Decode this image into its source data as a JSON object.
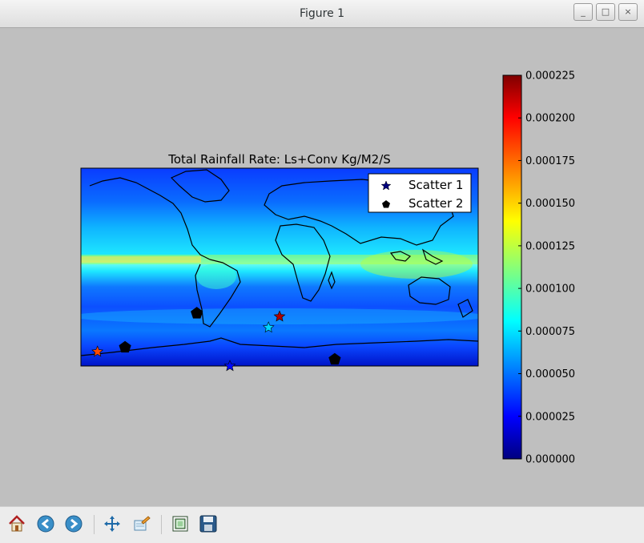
{
  "window": {
    "title": "Figure 1",
    "minimize_label": "_",
    "maximize_label": "□",
    "close_label": "×"
  },
  "chart_data": {
    "type": "heatmap",
    "title": "Total Rainfall Rate: Ls+Conv Kg/M2/S",
    "xlabel": "",
    "ylabel": "",
    "map": "world coastlines, global rainfall field",
    "colormap": "jet",
    "colorbar": {
      "ticks": [
        "0.000000",
        "0.000025",
        "0.000050",
        "0.000075",
        "0.000100",
        "0.000125",
        "0.000150",
        "0.000175",
        "0.000200",
        "0.000225"
      ],
      "vmin": 0,
      "vmax": 0.000225
    },
    "legend": {
      "placement": "top-right",
      "entries": [
        {
          "label": "Scatter 1",
          "marker": "star"
        },
        {
          "label": "Scatter 2",
          "marker": "pentagon"
        }
      ]
    },
    "scatter_series": [
      {
        "name": "Scatter 1",
        "marker": "star",
        "points": [
          {
            "lon": 0,
            "lat": -45,
            "value": 0.000215
          },
          {
            "lon": -10,
            "lat": -55,
            "value": 7.5e-05
          },
          {
            "lon": -165,
            "lat": -77,
            "value": 0.00018
          },
          {
            "lon": -45,
            "lat": -90,
            "value": 3e-05
          }
        ]
      },
      {
        "name": "Scatter 2",
        "marker": "pentagon",
        "points": [
          {
            "lon": -75,
            "lat": -42
          },
          {
            "lon": -140,
            "lat": -73
          },
          {
            "lon": 50,
            "lat": -84
          }
        ]
      }
    ]
  },
  "toolbar": {
    "buttons": [
      {
        "icon": "home-icon"
      },
      {
        "icon": "back-icon"
      },
      {
        "icon": "forward-icon"
      },
      {
        "icon": "pan-icon"
      },
      {
        "icon": "zoom-icon"
      },
      {
        "icon": "subplots-icon"
      },
      {
        "icon": "save-icon"
      }
    ]
  }
}
